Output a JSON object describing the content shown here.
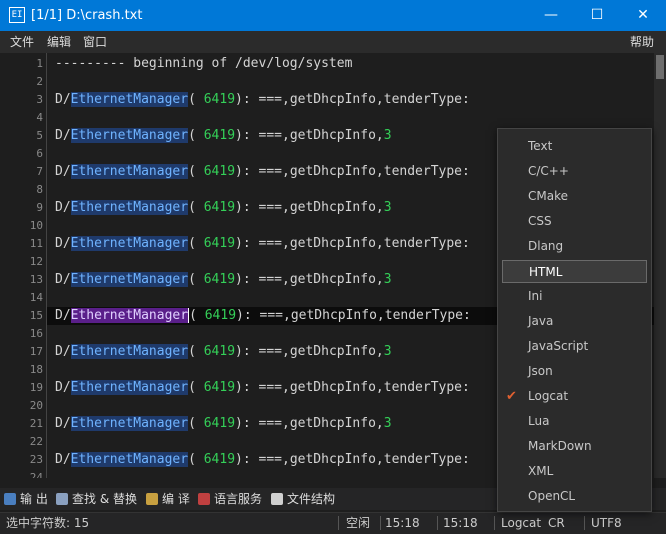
{
  "window": {
    "icon_text": "EI",
    "title": "[1/1] D:\\crash.txt",
    "minimize": "—",
    "maximize": "☐",
    "close": "✕"
  },
  "menu": {
    "file": "文件",
    "edit": "编辑",
    "window": "窗口",
    "help": "帮助"
  },
  "editor": {
    "line_numbers": [
      "1",
      "2",
      "3",
      "4",
      "5",
      "6",
      "7",
      "8",
      "9",
      "10",
      "11",
      "12",
      "13",
      "14",
      "15",
      "16",
      "17",
      "18",
      "19",
      "20",
      "21",
      "22",
      "23",
      "24"
    ],
    "header_line": "--------- beginning of /dev/log/system",
    "prefix": "D/",
    "tag": "EthernetManager",
    "paren_open": "( ",
    "pid": "6419",
    "long_tail": "): ===,getDhcpInfo,tenderType:",
    "short_tail": "): ===,getDhcpInfo,",
    "short_num": "3"
  },
  "popup": {
    "items": [
      "Text",
      "C/C++",
      "CMake",
      "CSS",
      "Dlang",
      "HTML",
      "Ini",
      "Java",
      "JavaScript",
      "Json",
      "Logcat",
      "Lua",
      "MarkDown",
      "XML",
      "OpenCL"
    ],
    "highlighted": "HTML",
    "checked": "Logcat",
    "check_mark": "✔"
  },
  "panels": {
    "output": "输 出",
    "find_replace": "查找 & 替换",
    "compile": "编 译",
    "lang_service": "语言服务",
    "file_structure": "文件结构"
  },
  "status": {
    "selection": "选中字符数: 15",
    "state": "空闲",
    "time1": "15:18",
    "time2": "15:18",
    "language": "Logcat",
    "eol": "CR",
    "encoding": "UTF8"
  },
  "colors": {
    "titlebar": "#0078d7",
    "tag_highlight": "#1f3a6b",
    "selected_tag": "#5a1f8a",
    "number": "#34d058",
    "check": "#e06030"
  }
}
